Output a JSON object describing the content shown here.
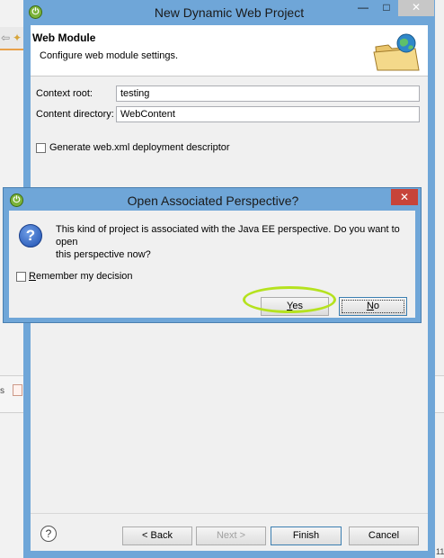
{
  "wizard": {
    "title": "New Dynamic Web Project",
    "header_title": "Web Module",
    "header_desc": "Configure web module settings.",
    "context_root_label": "Context root:",
    "context_root_value": "testing",
    "content_dir_label": "Content directory:",
    "content_dir_value": "WebContent",
    "generate_xml_label": "Generate web.xml deployment descriptor",
    "generate_xml_checked": false,
    "buttons": {
      "help": "?",
      "back": "< Back",
      "next": "Next >",
      "finish": "Finish",
      "cancel": "Cancel"
    }
  },
  "dialog": {
    "title": "Open Associated Perspective?",
    "message_line1": "This kind of project is associated with the Java EE perspective.  Do you want to open",
    "message_line2": "this perspective now?",
    "remember_label": "emember my decision",
    "remember_mnemonic": "R",
    "remember_checked": false,
    "yes_mnemonic": "Y",
    "yes_rest": "es",
    "no_mnemonic": "N",
    "no_rest": "o",
    "close_glyph": "✕"
  },
  "window_controls": {
    "minimize": "—",
    "maximize": "□",
    "close": "✕"
  },
  "background": {
    "left_tab_text": "s",
    "right_num": "11"
  },
  "colors": {
    "titlebar": "#6fa6d8",
    "dialog_close": "#c7443a",
    "highlight_ring": "#b5e21f",
    "eclipse_icon": "#7bb33a"
  },
  "icons": {
    "app": "eclipse-icon",
    "header_graphic": "folder-globe-icon",
    "dialog_question": "question-icon",
    "help": "help-icon"
  }
}
